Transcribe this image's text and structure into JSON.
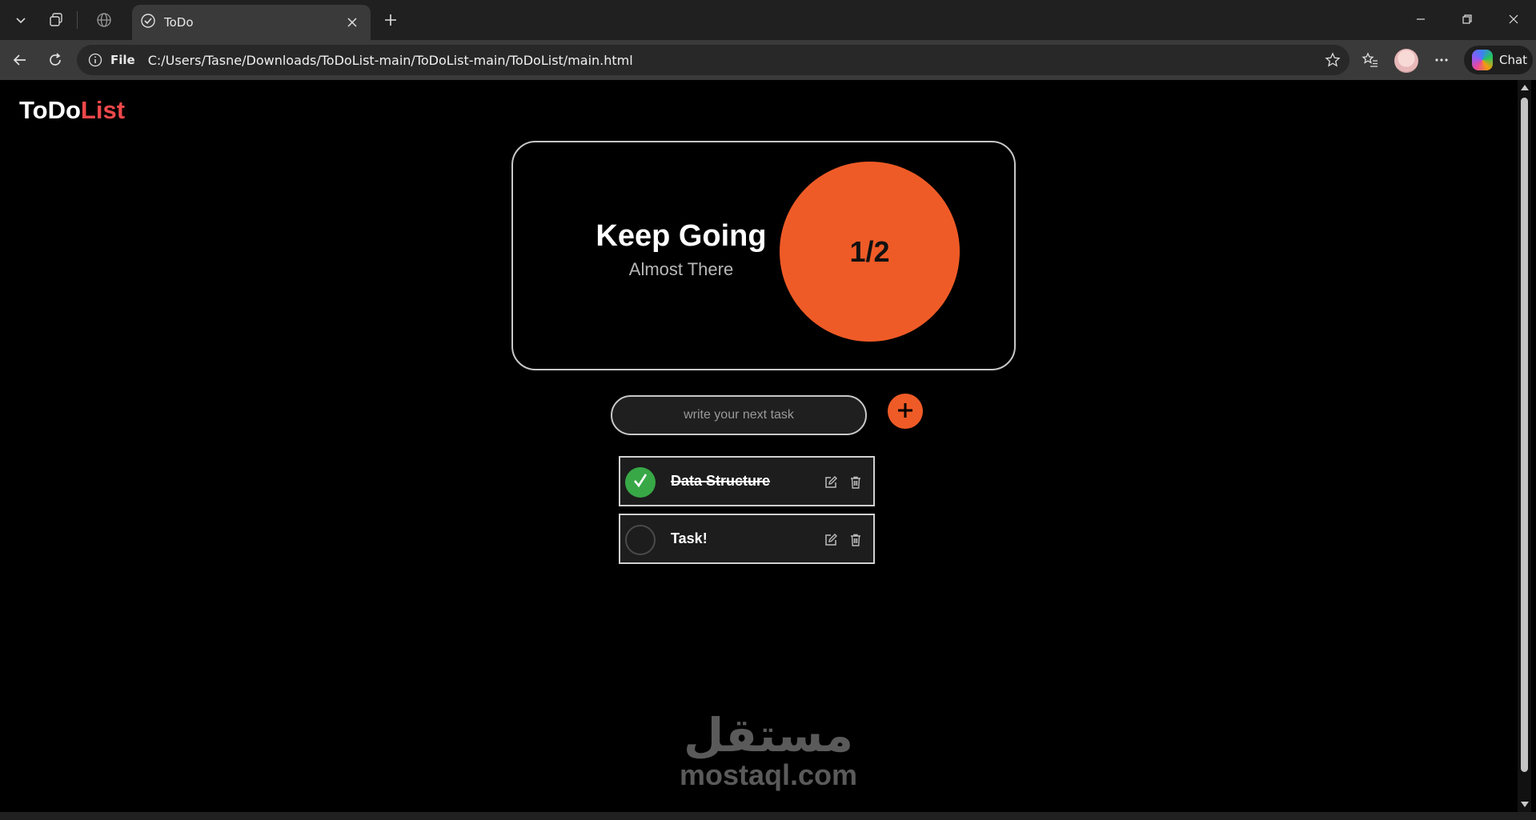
{
  "browser": {
    "tab_title": "ToDo",
    "url_scheme": "File",
    "url": "C:/Users/Tasne/Downloads/ToDoList-main/ToDoList-main/ToDoList/main.html",
    "chat_label": "Chat"
  },
  "app": {
    "logo_part1": "ToDo",
    "logo_part2": "List",
    "accent_color": "#ef5b27",
    "logo_accent_color": "#f0484a"
  },
  "progress_card": {
    "title": "Keep Going",
    "subtitle": "Almost There",
    "progress_text": "1/2",
    "completed": 1,
    "total": 2
  },
  "input": {
    "placeholder": "write your next task",
    "value": ""
  },
  "tasks": [
    {
      "text": "Data Structure",
      "completed": true
    },
    {
      "text": "Task!",
      "completed": false
    }
  ],
  "icons": {
    "edit": "edit-icon",
    "delete": "trash-icon",
    "add": "plus-icon",
    "check": "check-icon"
  },
  "watermark": {
    "arabic": "مستقل",
    "latin": "mostaql.com"
  }
}
